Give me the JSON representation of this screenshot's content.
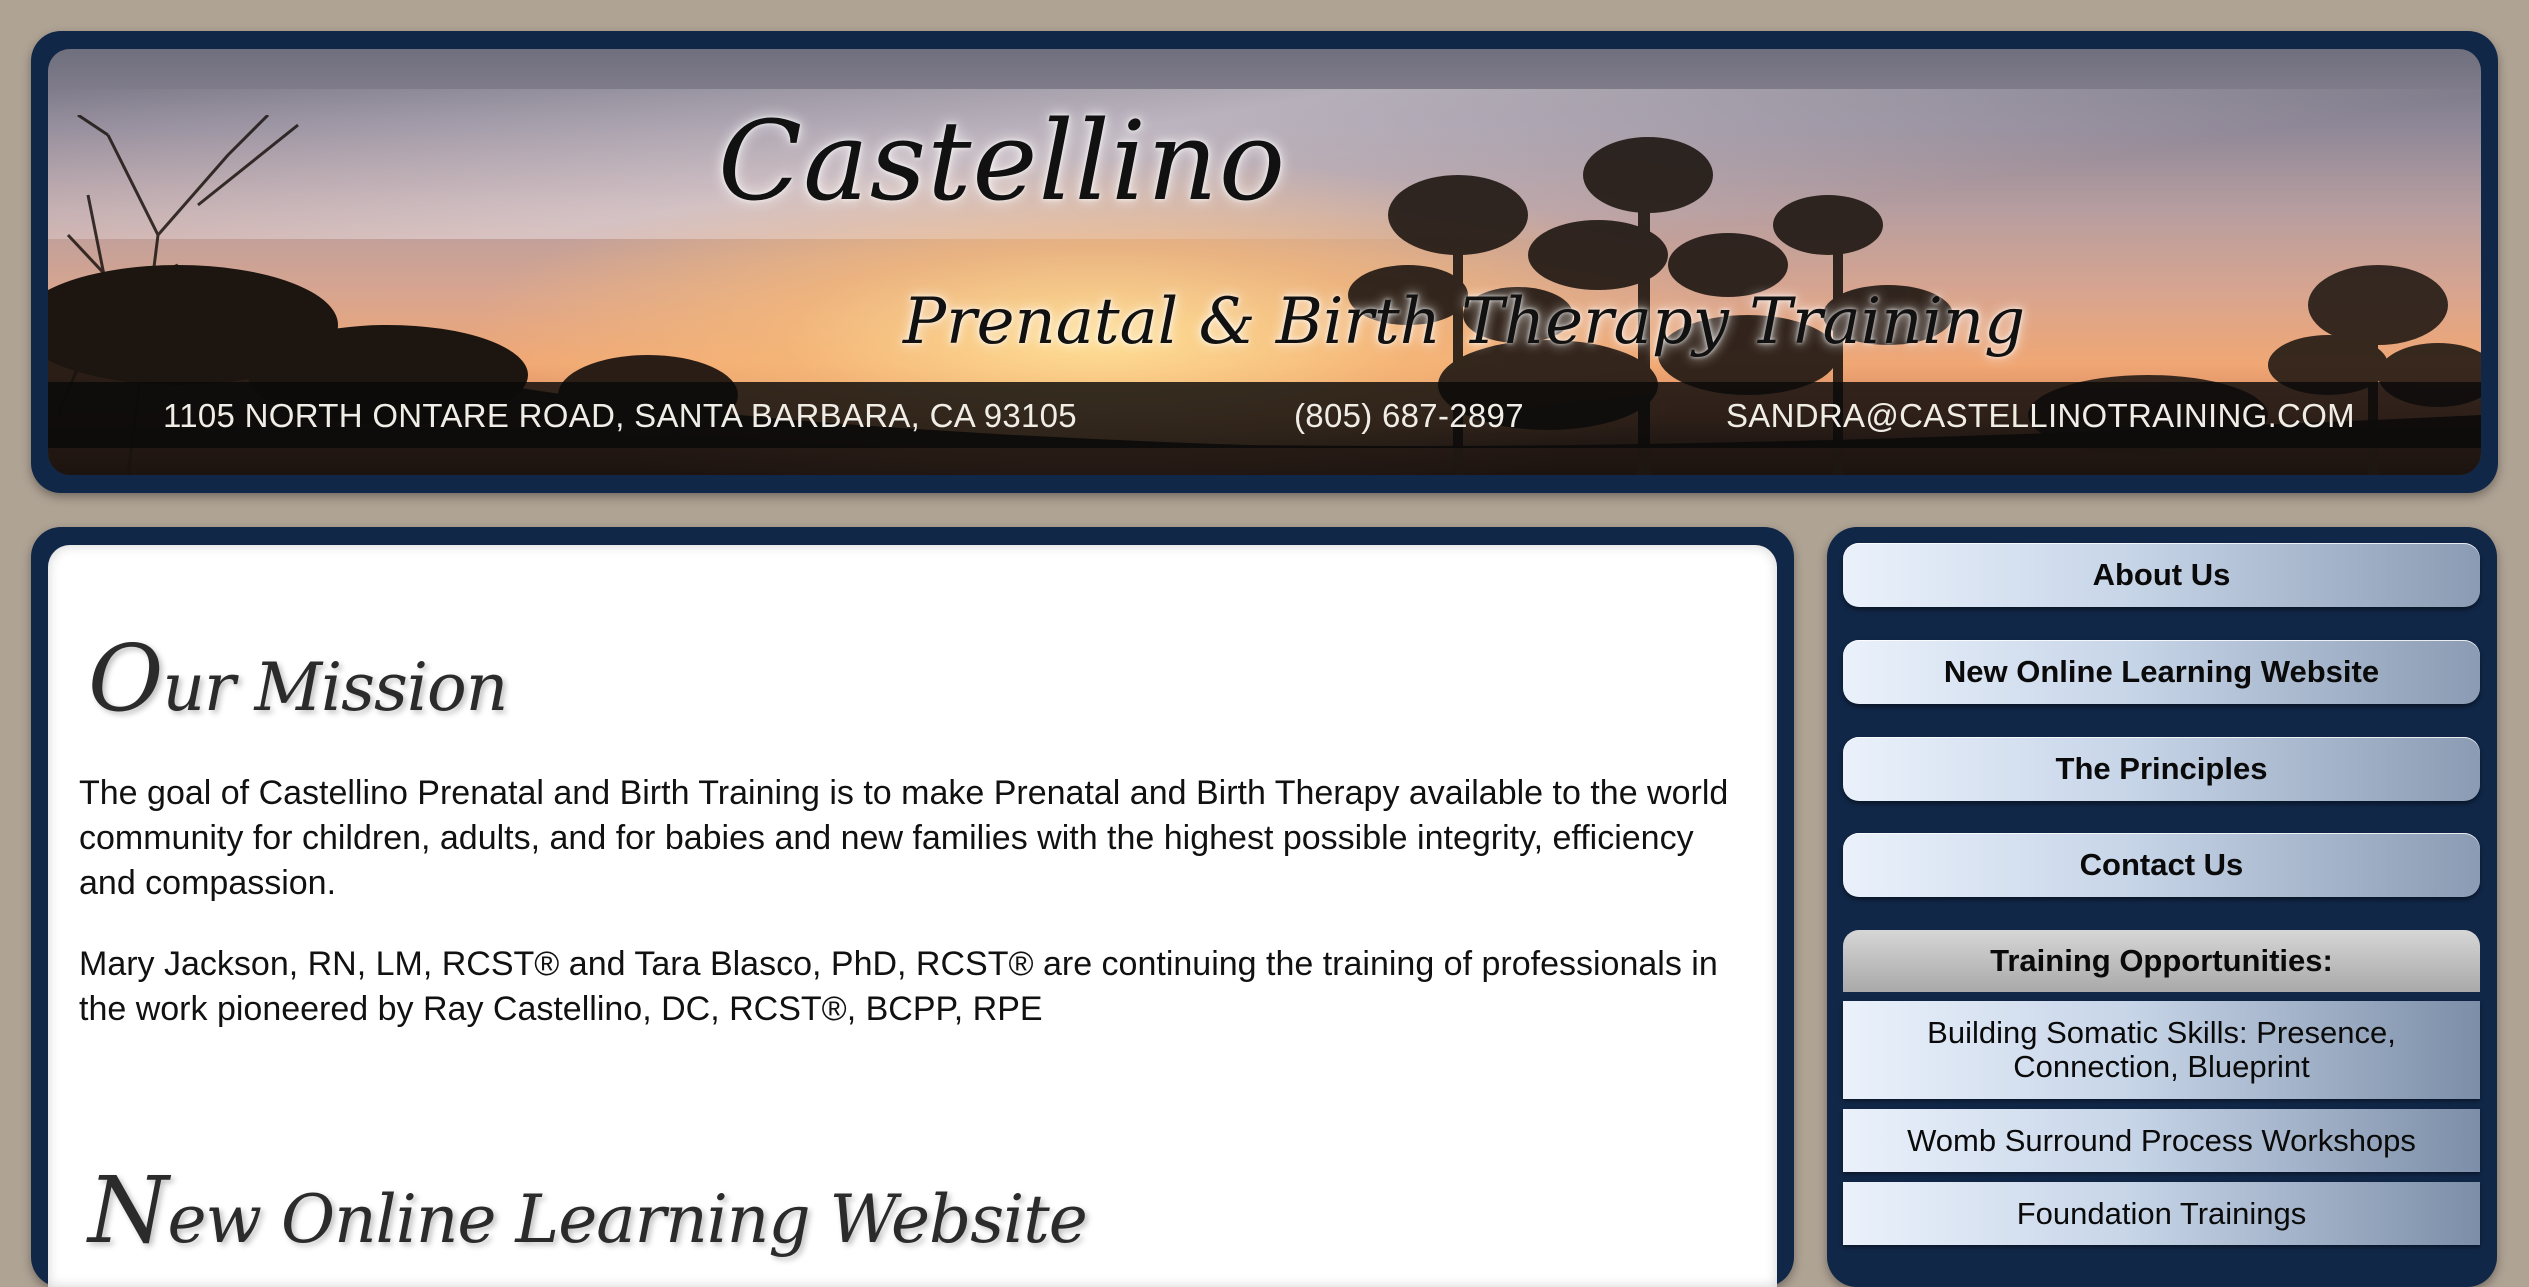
{
  "header": {
    "logo_title": "Castellino",
    "logo_subtitle": "Prenatal & Birth Therapy Training",
    "address": "1105 NORTH ONTARE ROAD, SANTA BARBARA, CA 93105",
    "phone": "(805) 687-2897",
    "email": "SANDRA@CASTELLINOTRAINING.COM"
  },
  "main": {
    "sections": [
      {
        "title_initial": "O",
        "title_rest": "ur Mission",
        "paragraphs": [
          "The goal of Castellino Prenatal and Birth Training is to make Prenatal and Birth Therapy available to the world community for children, adults, and for babies and new families with the highest possible integrity, efficiency and compassion.",
          "Mary Jackson, RN, LM, RCST® and Tara Blasco, PhD, RCST® are continuing the training of professionals in the work pioneered by Ray Castellino, DC, RCST®, BCPP, RPE"
        ]
      },
      {
        "title_initial": "N",
        "title_rest": "ew Online Learning Website"
      }
    ]
  },
  "sidebar": {
    "nav": [
      {
        "label": "About Us"
      },
      {
        "label": "New Online Learning Website"
      },
      {
        "label": "The Principles"
      },
      {
        "label": "Contact Us"
      }
    ],
    "training_heading": "Training Opportunities:",
    "training_items": [
      {
        "label": "Building Somatic Skills: Presence, Connection, Blueprint"
      },
      {
        "label": "Womb Surround Process Workshops"
      },
      {
        "label": "Foundation Trainings"
      }
    ]
  },
  "colors": {
    "page_background": "#afa394",
    "frame_navy": "#112748",
    "button_light": "#eaf1fb",
    "button_dark": "#8a9bb3"
  }
}
